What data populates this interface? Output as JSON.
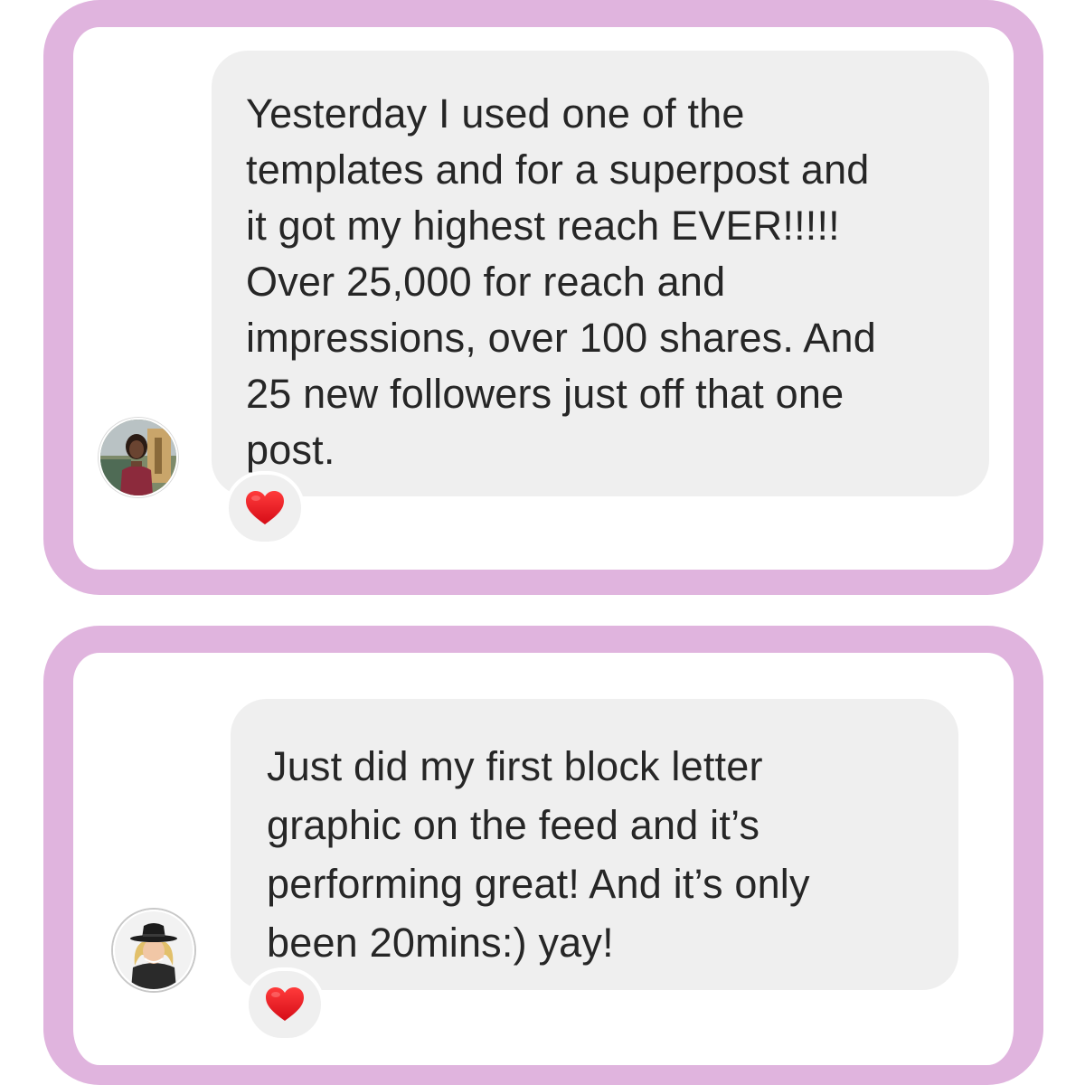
{
  "messages": [
    {
      "text": "Yesterday I used one of the templates and for a superpost and it got my highest reach EVER!!!!! Over 25,000 for reach and impressions, over 100 shares. And 25 new followers just off that one post.",
      "lines": [
        "Yesterday I used one of the",
        "templates and for a superpost and",
        "it got my highest reach EVER!!!!!",
        "Over 25,000 for reach and",
        "impressions, over 100 shares. And",
        "25 new followers just off that one",
        "post."
      ],
      "reaction": "heart-icon",
      "avatar": "avatar-photo-woman-dark-hair"
    },
    {
      "text": "Just did my first block letter graphic on the feed and it’s performing great! And it’s only been 20mins:) yay!",
      "lines": [
        "Just did my first block letter",
        "graphic on the feed and it’s",
        "performing great! And it’s only",
        "been 20mins:) yay!"
      ],
      "reaction": "heart-icon",
      "avatar": "avatar-photo-woman-black-hat"
    }
  ],
  "colors": {
    "frame": "#e0b4de",
    "bubble": "#efefef",
    "text": "#262626",
    "heart": "#e3121b"
  }
}
